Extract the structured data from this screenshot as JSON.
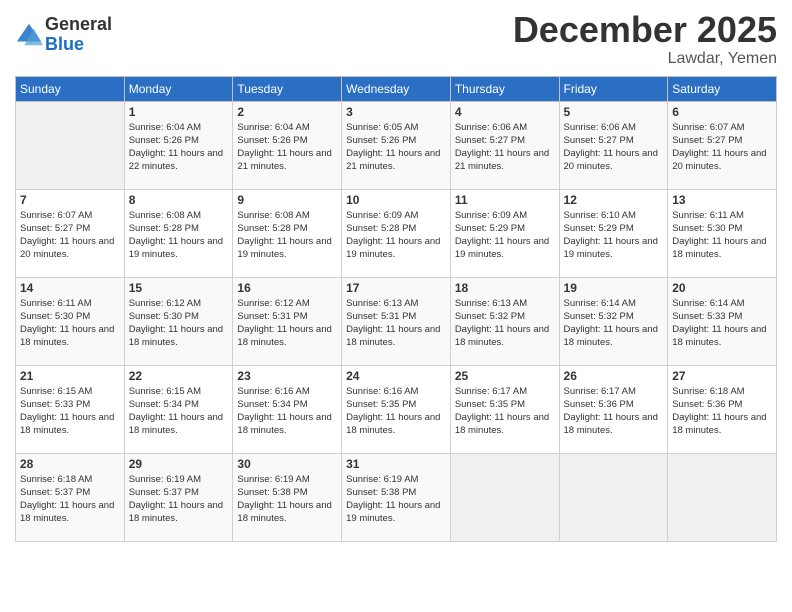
{
  "logo": {
    "general": "General",
    "blue": "Blue"
  },
  "title": "December 2025",
  "location": "Lawdar, Yemen",
  "days_of_week": [
    "Sunday",
    "Monday",
    "Tuesday",
    "Wednesday",
    "Thursday",
    "Friday",
    "Saturday"
  ],
  "weeks": [
    [
      {
        "day": "",
        "sunrise": "",
        "sunset": "",
        "daylight": ""
      },
      {
        "day": "1",
        "sunrise": "Sunrise: 6:04 AM",
        "sunset": "Sunset: 5:26 PM",
        "daylight": "Daylight: 11 hours and 22 minutes."
      },
      {
        "day": "2",
        "sunrise": "Sunrise: 6:04 AM",
        "sunset": "Sunset: 5:26 PM",
        "daylight": "Daylight: 11 hours and 21 minutes."
      },
      {
        "day": "3",
        "sunrise": "Sunrise: 6:05 AM",
        "sunset": "Sunset: 5:26 PM",
        "daylight": "Daylight: 11 hours and 21 minutes."
      },
      {
        "day": "4",
        "sunrise": "Sunrise: 6:06 AM",
        "sunset": "Sunset: 5:27 PM",
        "daylight": "Daylight: 11 hours and 21 minutes."
      },
      {
        "day": "5",
        "sunrise": "Sunrise: 6:06 AM",
        "sunset": "Sunset: 5:27 PM",
        "daylight": "Daylight: 11 hours and 20 minutes."
      },
      {
        "day": "6",
        "sunrise": "Sunrise: 6:07 AM",
        "sunset": "Sunset: 5:27 PM",
        "daylight": "Daylight: 11 hours and 20 minutes."
      }
    ],
    [
      {
        "day": "7",
        "sunrise": "Sunrise: 6:07 AM",
        "sunset": "Sunset: 5:27 PM",
        "daylight": "Daylight: 11 hours and 20 minutes."
      },
      {
        "day": "8",
        "sunrise": "Sunrise: 6:08 AM",
        "sunset": "Sunset: 5:28 PM",
        "daylight": "Daylight: 11 hours and 19 minutes."
      },
      {
        "day": "9",
        "sunrise": "Sunrise: 6:08 AM",
        "sunset": "Sunset: 5:28 PM",
        "daylight": "Daylight: 11 hours and 19 minutes."
      },
      {
        "day": "10",
        "sunrise": "Sunrise: 6:09 AM",
        "sunset": "Sunset: 5:28 PM",
        "daylight": "Daylight: 11 hours and 19 minutes."
      },
      {
        "day": "11",
        "sunrise": "Sunrise: 6:09 AM",
        "sunset": "Sunset: 5:29 PM",
        "daylight": "Daylight: 11 hours and 19 minutes."
      },
      {
        "day": "12",
        "sunrise": "Sunrise: 6:10 AM",
        "sunset": "Sunset: 5:29 PM",
        "daylight": "Daylight: 11 hours and 19 minutes."
      },
      {
        "day": "13",
        "sunrise": "Sunrise: 6:11 AM",
        "sunset": "Sunset: 5:30 PM",
        "daylight": "Daylight: 11 hours and 18 minutes."
      }
    ],
    [
      {
        "day": "14",
        "sunrise": "Sunrise: 6:11 AM",
        "sunset": "Sunset: 5:30 PM",
        "daylight": "Daylight: 11 hours and 18 minutes."
      },
      {
        "day": "15",
        "sunrise": "Sunrise: 6:12 AM",
        "sunset": "Sunset: 5:30 PM",
        "daylight": "Daylight: 11 hours and 18 minutes."
      },
      {
        "day": "16",
        "sunrise": "Sunrise: 6:12 AM",
        "sunset": "Sunset: 5:31 PM",
        "daylight": "Daylight: 11 hours and 18 minutes."
      },
      {
        "day": "17",
        "sunrise": "Sunrise: 6:13 AM",
        "sunset": "Sunset: 5:31 PM",
        "daylight": "Daylight: 11 hours and 18 minutes."
      },
      {
        "day": "18",
        "sunrise": "Sunrise: 6:13 AM",
        "sunset": "Sunset: 5:32 PM",
        "daylight": "Daylight: 11 hours and 18 minutes."
      },
      {
        "day": "19",
        "sunrise": "Sunrise: 6:14 AM",
        "sunset": "Sunset: 5:32 PM",
        "daylight": "Daylight: 11 hours and 18 minutes."
      },
      {
        "day": "20",
        "sunrise": "Sunrise: 6:14 AM",
        "sunset": "Sunset: 5:33 PM",
        "daylight": "Daylight: 11 hours and 18 minutes."
      }
    ],
    [
      {
        "day": "21",
        "sunrise": "Sunrise: 6:15 AM",
        "sunset": "Sunset: 5:33 PM",
        "daylight": "Daylight: 11 hours and 18 minutes."
      },
      {
        "day": "22",
        "sunrise": "Sunrise: 6:15 AM",
        "sunset": "Sunset: 5:34 PM",
        "daylight": "Daylight: 11 hours and 18 minutes."
      },
      {
        "day": "23",
        "sunrise": "Sunrise: 6:16 AM",
        "sunset": "Sunset: 5:34 PM",
        "daylight": "Daylight: 11 hours and 18 minutes."
      },
      {
        "day": "24",
        "sunrise": "Sunrise: 6:16 AM",
        "sunset": "Sunset: 5:35 PM",
        "daylight": "Daylight: 11 hours and 18 minutes."
      },
      {
        "day": "25",
        "sunrise": "Sunrise: 6:17 AM",
        "sunset": "Sunset: 5:35 PM",
        "daylight": "Daylight: 11 hours and 18 minutes."
      },
      {
        "day": "26",
        "sunrise": "Sunrise: 6:17 AM",
        "sunset": "Sunset: 5:36 PM",
        "daylight": "Daylight: 11 hours and 18 minutes."
      },
      {
        "day": "27",
        "sunrise": "Sunrise: 6:18 AM",
        "sunset": "Sunset: 5:36 PM",
        "daylight": "Daylight: 11 hours and 18 minutes."
      }
    ],
    [
      {
        "day": "28",
        "sunrise": "Sunrise: 6:18 AM",
        "sunset": "Sunset: 5:37 PM",
        "daylight": "Daylight: 11 hours and 18 minutes."
      },
      {
        "day": "29",
        "sunrise": "Sunrise: 6:19 AM",
        "sunset": "Sunset: 5:37 PM",
        "daylight": "Daylight: 11 hours and 18 minutes."
      },
      {
        "day": "30",
        "sunrise": "Sunrise: 6:19 AM",
        "sunset": "Sunset: 5:38 PM",
        "daylight": "Daylight: 11 hours and 18 minutes."
      },
      {
        "day": "31",
        "sunrise": "Sunrise: 6:19 AM",
        "sunset": "Sunset: 5:38 PM",
        "daylight": "Daylight: 11 hours and 19 minutes."
      },
      {
        "day": "",
        "sunrise": "",
        "sunset": "",
        "daylight": ""
      },
      {
        "day": "",
        "sunrise": "",
        "sunset": "",
        "daylight": ""
      },
      {
        "day": "",
        "sunrise": "",
        "sunset": "",
        "daylight": ""
      }
    ]
  ]
}
